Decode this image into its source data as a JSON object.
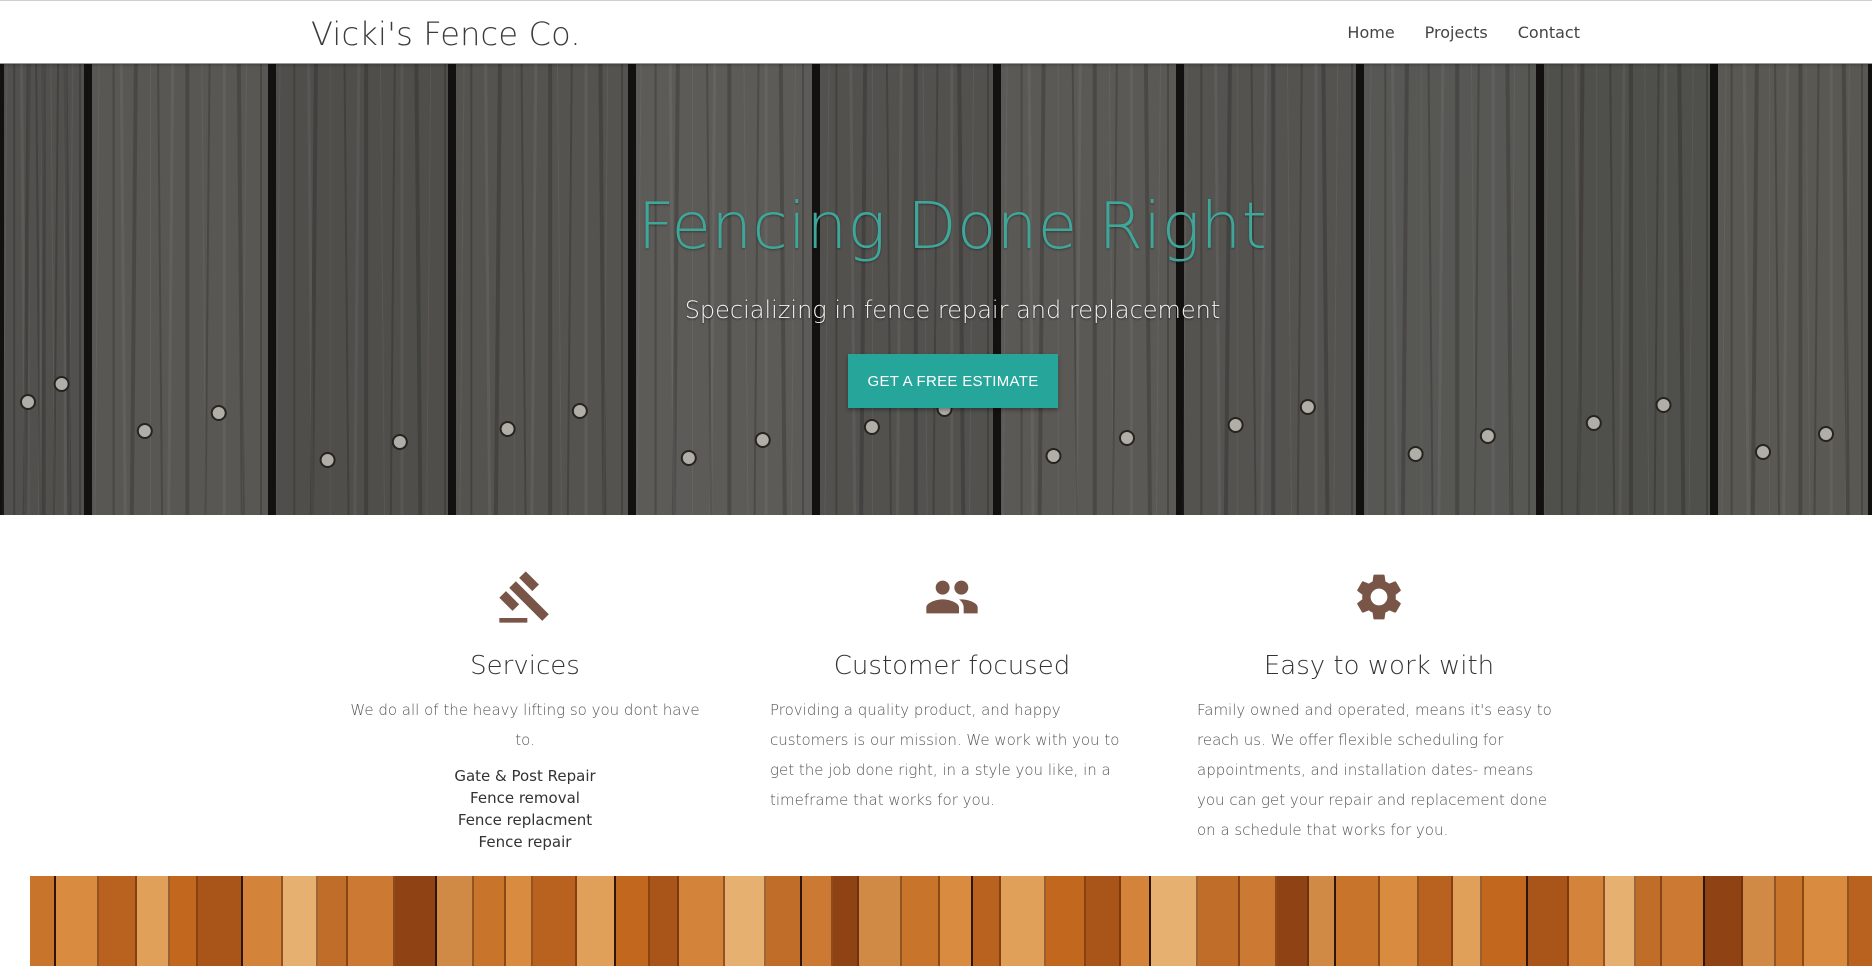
{
  "nav": {
    "brand": "Vicki's Fence Co.",
    "links": [
      "Home",
      "Projects",
      "Contact"
    ]
  },
  "hero": {
    "title": "Fencing Done Right",
    "subtitle": "Specializing in fence repair and replacement",
    "cta_label": "GET A FREE ESTIMATE"
  },
  "features": [
    {
      "icon": "gavel-icon",
      "title": "Services",
      "description": "We do all of the heavy lifting so you dont have to.",
      "list": [
        "Gate & Post Repair",
        "Fence removal",
        "Fence replacment",
        "Fence repair"
      ]
    },
    {
      "icon": "people-icon",
      "title": "Customer focused",
      "description": "Providing a quality product, and happy customers is our mission. We work with you to get the job done right, in a style you like, in a timeframe that works for you."
    },
    {
      "icon": "gear-icon",
      "title": "Easy to work with",
      "description": "Family owned and operated, means it's easy to reach us. We offer flexible scheduling for appointments, and installation dates- means you can get your repair and replacement done on a schedule that works for you."
    }
  ],
  "colors": {
    "accent": "#26a69a",
    "hero_title": "#3fa69a",
    "icon": "#795548"
  }
}
